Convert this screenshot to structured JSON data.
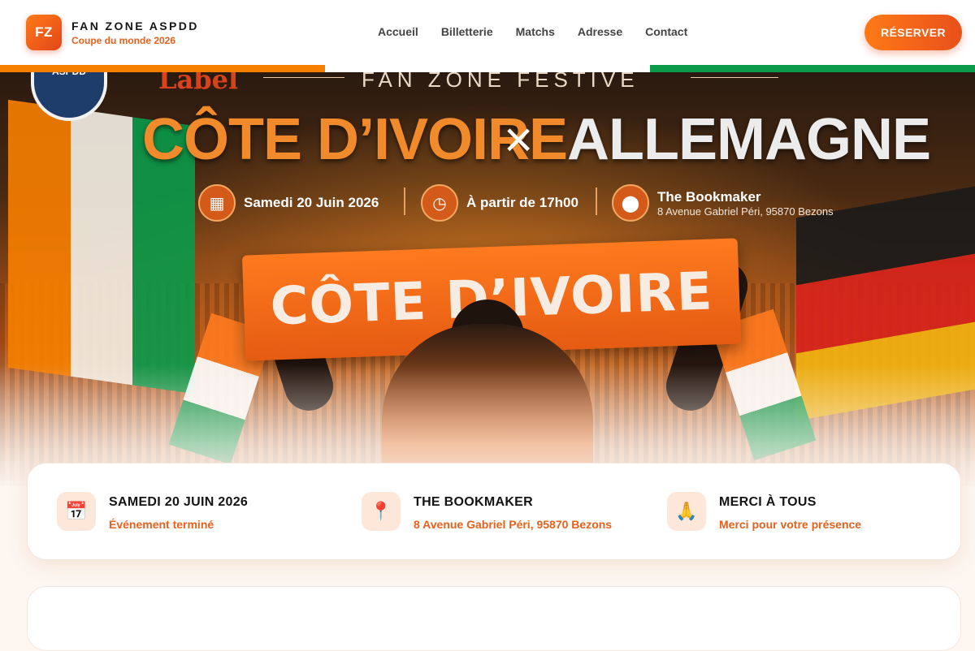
{
  "brand": {
    "logo_text": "FZ",
    "title": "FAN ZONE ASPDD",
    "subtitle": "Coupe du monde 2026"
  },
  "nav": {
    "items": [
      "Accueil",
      "Billetterie",
      "Matchs",
      "Adresse",
      "Contact"
    ]
  },
  "cta": {
    "label": "RÉSERVER"
  },
  "colors": {
    "accent": "#e8601c",
    "orange": "#f77f00",
    "white": "#ffffff",
    "green": "#0a9a4a"
  },
  "hero": {
    "club_badge": "ASPDD",
    "partner_word": "Label",
    "tagline": "FAN ZONE FESTIVE",
    "team_home": "CÔTE D’IVOIRE",
    "separator": "×",
    "team_away": "ALLEMAGNE",
    "date": "Samedi 20 Juin 2026",
    "time": "À partir de 17h00",
    "venue_name": "The Bookmaker",
    "venue_address": "8 Avenue Gabriel Péri, 95870 Bezons",
    "scarf_text": "CÔTE D’IVOIRE",
    "icons": [
      "calendar-icon",
      "clock-icon",
      "location-pin-icon"
    ]
  },
  "info_card": {
    "items": [
      {
        "icon": "📅",
        "icon_name": "calendar-icon",
        "title": "SAMEDI 20 JUIN 2026",
        "subtitle": "Événement terminé"
      },
      {
        "icon": "📍",
        "icon_name": "location-pin-icon",
        "title": "THE BOOKMAKER",
        "subtitle": "8 Avenue Gabriel Péri, 95870 Bezons"
      },
      {
        "icon": "🙏",
        "icon_name": "praying-hands-icon",
        "title": "MERCI À TOUS",
        "subtitle": "Merci pour votre présence"
      }
    ]
  }
}
